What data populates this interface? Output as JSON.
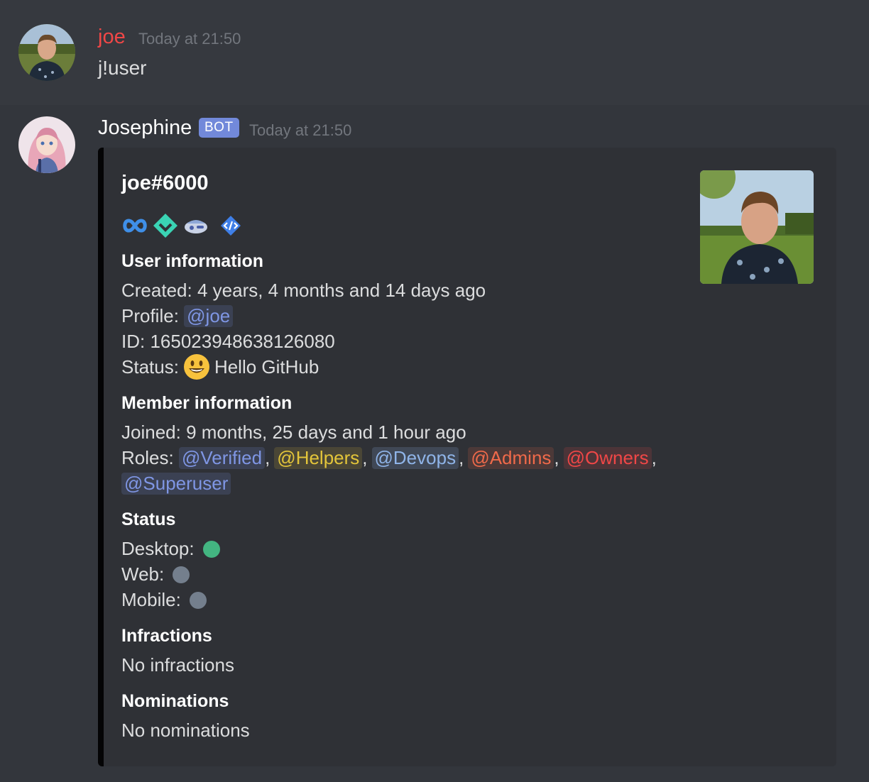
{
  "messages": [
    {
      "author": "joe",
      "author_color": "#f04747",
      "timestamp": "Today at 21:50",
      "content": "j!user"
    },
    {
      "author": "Josephine",
      "bot_tag": "BOT",
      "timestamp": "Today at 21:50"
    }
  ],
  "embed": {
    "title": "joe#6000",
    "badges": [
      "hypesquad-balance-icon",
      "verified-bot-dev-icon",
      "partner-icon",
      "dev-icon"
    ],
    "user_info": {
      "heading": "User information",
      "created_label": "Created:",
      "created_value": "4 years, 4 months and 14 days ago",
      "profile_label": "Profile:",
      "profile_mention": "@joe",
      "id_label": "ID:",
      "id_value": "165023948638126080",
      "status_label": "Status:",
      "status_emoji": "smiley-emoji",
      "status_text": "Hello GitHub"
    },
    "member_info": {
      "heading": "Member information",
      "joined_label": "Joined:",
      "joined_value": "9 months, 25 days and 1 hour ago",
      "roles_label": "Roles:",
      "roles": [
        {
          "name": "@Verified",
          "color": "#7f96e4",
          "bg": "rgba(114,137,218,0.18)"
        },
        {
          "name": "@Helpers",
          "color": "#e3c53a",
          "bg": "rgba(227,197,58,0.15)"
        },
        {
          "name": "@Devops",
          "color": "#8fb4e8",
          "bg": "rgba(143,180,232,0.18)"
        },
        {
          "name": "@Admins",
          "color": "#f06a4a",
          "bg": "rgba(240,106,74,0.15)"
        },
        {
          "name": "@Owners",
          "color": "#f04747",
          "bg": "rgba(240,71,71,0.15)"
        },
        {
          "name": "@Superuser",
          "color": "#7f96e4",
          "bg": "rgba(114,137,218,0.18)"
        }
      ],
      "separator": ","
    },
    "status": {
      "heading": "Status",
      "desktop_label": "Desktop:",
      "desktop_color": "#43b581",
      "web_label": "Web:",
      "web_color": "#747f8d",
      "mobile_label": "Mobile:",
      "mobile_color": "#747f8d"
    },
    "infractions": {
      "heading": "Infractions",
      "text": "No infractions"
    },
    "nominations": {
      "heading": "Nominations",
      "text": "No nominations"
    }
  }
}
